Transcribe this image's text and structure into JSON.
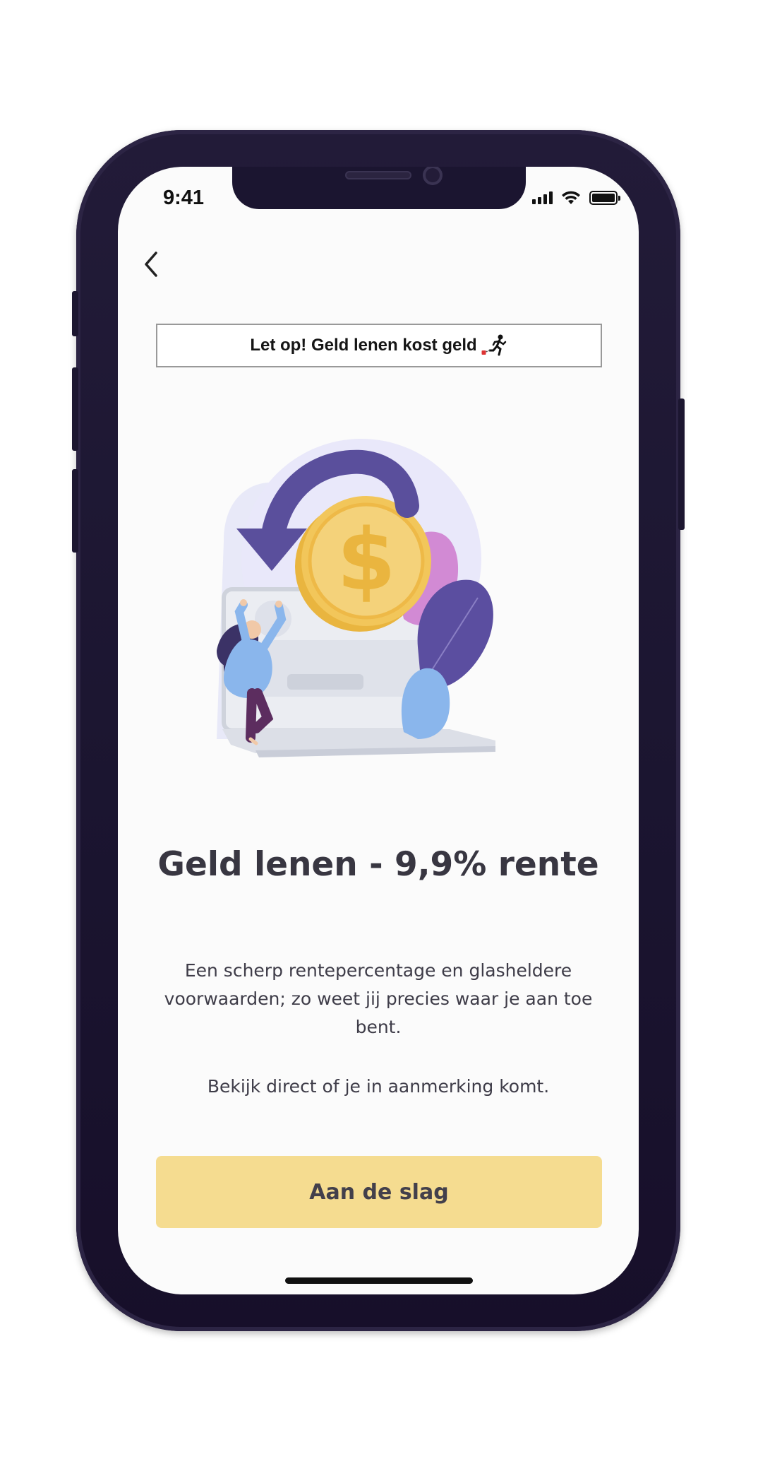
{
  "status_bar": {
    "time": "9:41"
  },
  "navigation": {
    "back_icon": "chevron-left-icon"
  },
  "warning": {
    "text": "Let op! Geld lenen kost geld",
    "icon": "person-running-with-ball-and-chain-icon"
  },
  "illustration": {
    "subject": "money-transfer-illustration"
  },
  "content": {
    "title": "Geld lenen - 9,9% rente",
    "paragraph_1": "Een scherp rentepercentage en glasheldere voorwaarden; zo weet jij precies waar je aan toe bent.",
    "paragraph_2": "Bekijk direct of je in aanmerking komt."
  },
  "actions": {
    "primary_label": "Aan de slag"
  },
  "colors": {
    "frame": "#1b1530",
    "screen_bg": "#fbfbfb",
    "button_bg": "#f5dc90",
    "arrow_purple": "#5a4f9c",
    "coin_gold": "#f2c65a",
    "text_dark": "#383641"
  }
}
